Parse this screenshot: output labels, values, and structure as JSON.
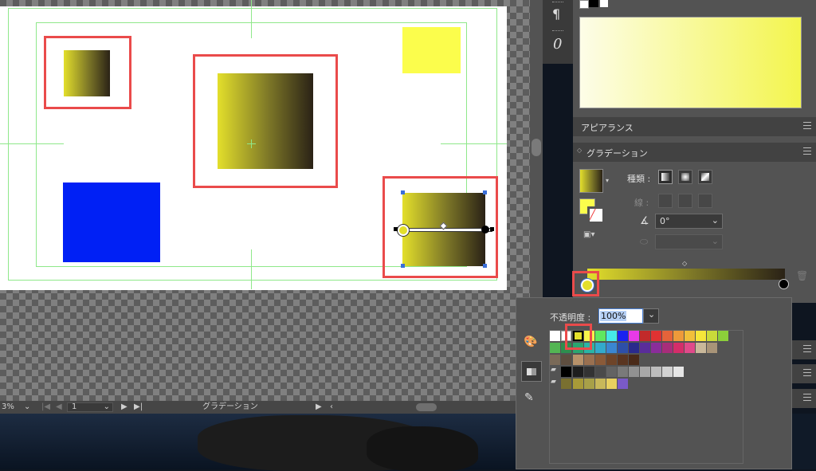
{
  "statusbar": {
    "zoom": "3%",
    "page": "1",
    "tool_name": "グラデーション"
  },
  "tools": {
    "pilcrow": "¶",
    "italic_zero": "0"
  },
  "appearance": {
    "title": "アピアランス"
  },
  "gradient": {
    "title": "グラデーション",
    "type_label": "種類 :",
    "stroke_label": "線 :",
    "angle_value": "0°"
  },
  "opacity": {
    "label": "不透明度 :",
    "value": "100%"
  },
  "colors": {
    "accent": "#ea4b4b",
    "yellow": "#fbfd4c",
    "blue": "#0020f5",
    "panel": "#535353"
  },
  "icons": [
    "pilcrow-icon",
    "italic-zero-icon",
    "menu-icon",
    "linear-gradient-icon",
    "radial-gradient-icon",
    "freeform-gradient-icon",
    "angle-icon",
    "aspect-icon",
    "trash-icon",
    "palette-icon",
    "swatches-icon",
    "eyedropper-icon",
    "folder-icon",
    "chevron-down-icon"
  ]
}
